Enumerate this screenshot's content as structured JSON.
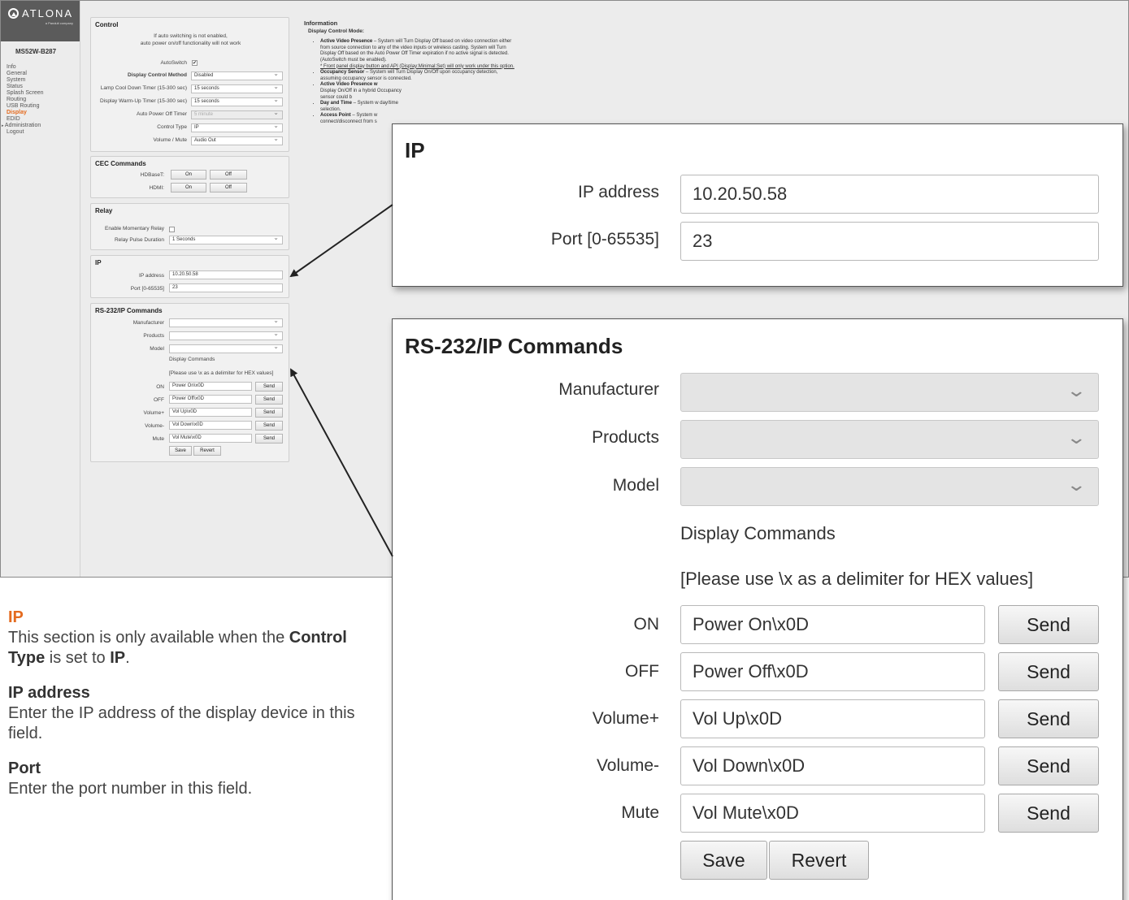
{
  "sidebar": {
    "logo": "ATLONA",
    "logo_sub": "a Panduit company",
    "model": "MS52W-B287",
    "items": [
      "Info",
      "General",
      "System",
      "Status",
      "Splash Screen",
      "Routing",
      "USB Routing",
      "Display",
      "EDID",
      "Administration",
      "Logout"
    ]
  },
  "control": {
    "title": "Control",
    "note_line1": "If auto switching is not enabled,",
    "note_line2": "auto power on/off functionality will not work",
    "autoswitch_label": "AutoSwitch",
    "autoswitch_checked": "✔",
    "method_label": "Display Control Method",
    "method_value": "Disabled",
    "lamp_label": "Lamp Cool Down Timer (15-300 sec)",
    "lamp_value": "15 seconds",
    "warmup_label": "Display Warm-Up Timer (15-300 sec)",
    "warmup_value": "15 seconds",
    "autooff_label": "Auto Power Off Timer",
    "autooff_value": "5 minute",
    "type_label": "Control Type",
    "type_value": "IP",
    "volume_label": "Volume / Mute",
    "volume_value": "Audio Out"
  },
  "cec": {
    "title": "CEC Commands",
    "hdbaset_label": "HDBaseT:",
    "hdmi_label": "HDMI:",
    "on": "On",
    "off": "Off"
  },
  "relay": {
    "title": "Relay",
    "momentary_label": "Enable Momentary Relay",
    "duration_label": "Relay Pulse Duration",
    "duration_value": "1 Seconds"
  },
  "ip": {
    "title": "IP",
    "address_label": "IP address",
    "address_value": "10.20.50.58",
    "port_label": "Port [0-65535]",
    "port_value": "23"
  },
  "rs232": {
    "title": "RS-232/IP Commands",
    "manufacturer_label": "Manufacturer",
    "products_label": "Products",
    "model_label": "Model",
    "display_commands": "Display Commands",
    "hex_note": "[Please use \\x as a delimiter for HEX values]",
    "commands": [
      {
        "label": "ON",
        "value": "Power On\\x0D"
      },
      {
        "label": "OFF",
        "value": "Power Off\\x0D"
      },
      {
        "label": "Volume+",
        "value": "Vol Up\\x0D"
      },
      {
        "label": "Volume-",
        "value": "Vol Down\\x0D"
      },
      {
        "label": "Mute",
        "value": "Vol Mute\\x0D"
      }
    ],
    "send": "Send",
    "save": "Save",
    "revert": "Revert"
  },
  "info": {
    "title": "Information",
    "subtitle": "Display Control Mode:",
    "b1_head": "Active Video Presence",
    "b1_text": " – System will Turn Display Off based on video connection either from source connection to any of the video inputs or wireless casting. System will Turn Display Off based on the Auto Power Off Timer expiration if no active signal is detected. (AutoSwitch must be enabled).",
    "b1_note": "* Front panel display button and API (Display:Minimal:Set) will only work under this option.",
    "b2_head": "Occupancy Sensor",
    "b2_text": " – System will Turn Display On/Off upon occupancy detection, assuming occupancy sensor is connected.",
    "b3_head": "Active Video Presence w",
    "b3_text": "Display On/Off in a hybrid Occupancy sensor could b",
    "b4_head": "Day and Time",
    "b4_text": " – System w day/time selection.",
    "b5_head": "Access Point",
    "b5_text": " – System w connect/disconnect from s"
  },
  "description": {
    "section": "IP",
    "intro_pre": "This section is only available when the ",
    "intro_term": "Control Type",
    "intro_mid": " is set to ",
    "intro_val": "IP",
    "intro_post": ".",
    "ip_term": "IP address",
    "ip_text": "Enter the IP address of the display device in this field.",
    "port_term": "Port",
    "port_text": "Enter the port number in this field."
  },
  "colors": {
    "accent": "#e46b1f",
    "logo_band": "#5b5b5b"
  }
}
